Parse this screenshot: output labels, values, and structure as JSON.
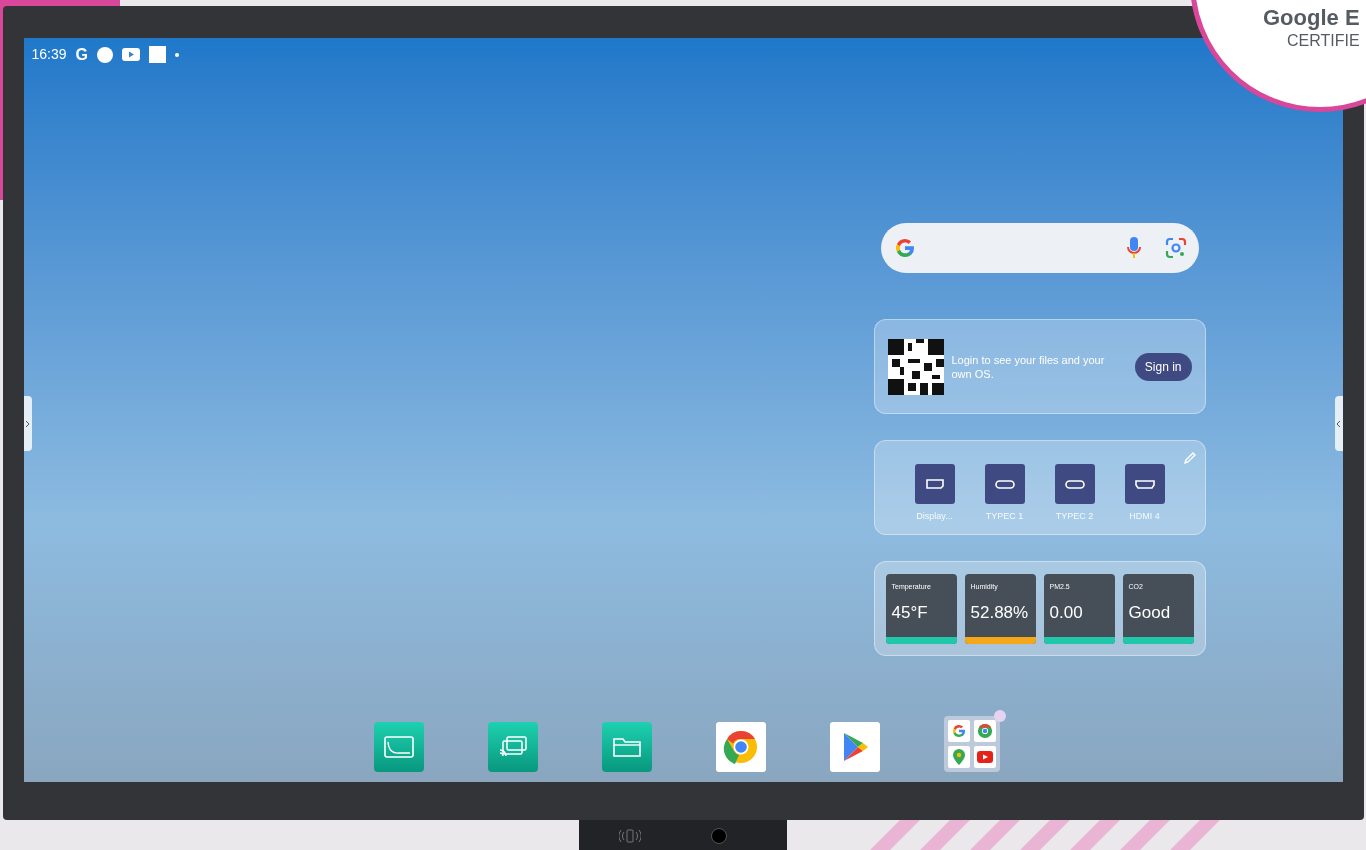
{
  "badge": {
    "title": "Google E",
    "subtitle": "CERTIFIE"
  },
  "status_bar": {
    "time": "16:39",
    "icons": [
      {
        "kind": "letter",
        "text": "G"
      },
      {
        "kind": "circle"
      },
      {
        "kind": "video"
      },
      {
        "kind": "square"
      },
      {
        "kind": "dot"
      }
    ]
  },
  "login_card": {
    "message": "Login to see your files and your own OS.",
    "button": "Sign in"
  },
  "inputs_card": {
    "sources": [
      {
        "kind": "displayport",
        "label": "Display..."
      },
      {
        "kind": "typec",
        "label": "TYPEC 1"
      },
      {
        "kind": "typec",
        "label": "TYPEC 2"
      },
      {
        "kind": "hdmi",
        "label": "HDMI 4"
      }
    ]
  },
  "sensors": [
    {
      "label": "Temperature",
      "value": "45°F",
      "color": "#1ec8a8"
    },
    {
      "label": "Humidity",
      "value": "52.88%",
      "color": "#f4a718"
    },
    {
      "label": "PM2.5",
      "value": "0.00",
      "color": "#1ec8a8"
    },
    {
      "label": "CO2",
      "value": "Good",
      "color": "#1ec8a8"
    }
  ],
  "dock": [
    {
      "kind": "whiteboard",
      "notification": false
    },
    {
      "kind": "cast",
      "notification": false
    },
    {
      "kind": "files",
      "notification": false
    },
    {
      "kind": "chrome",
      "notification": false
    },
    {
      "kind": "play",
      "notification": false
    },
    {
      "kind": "folder",
      "notification": true
    }
  ]
}
